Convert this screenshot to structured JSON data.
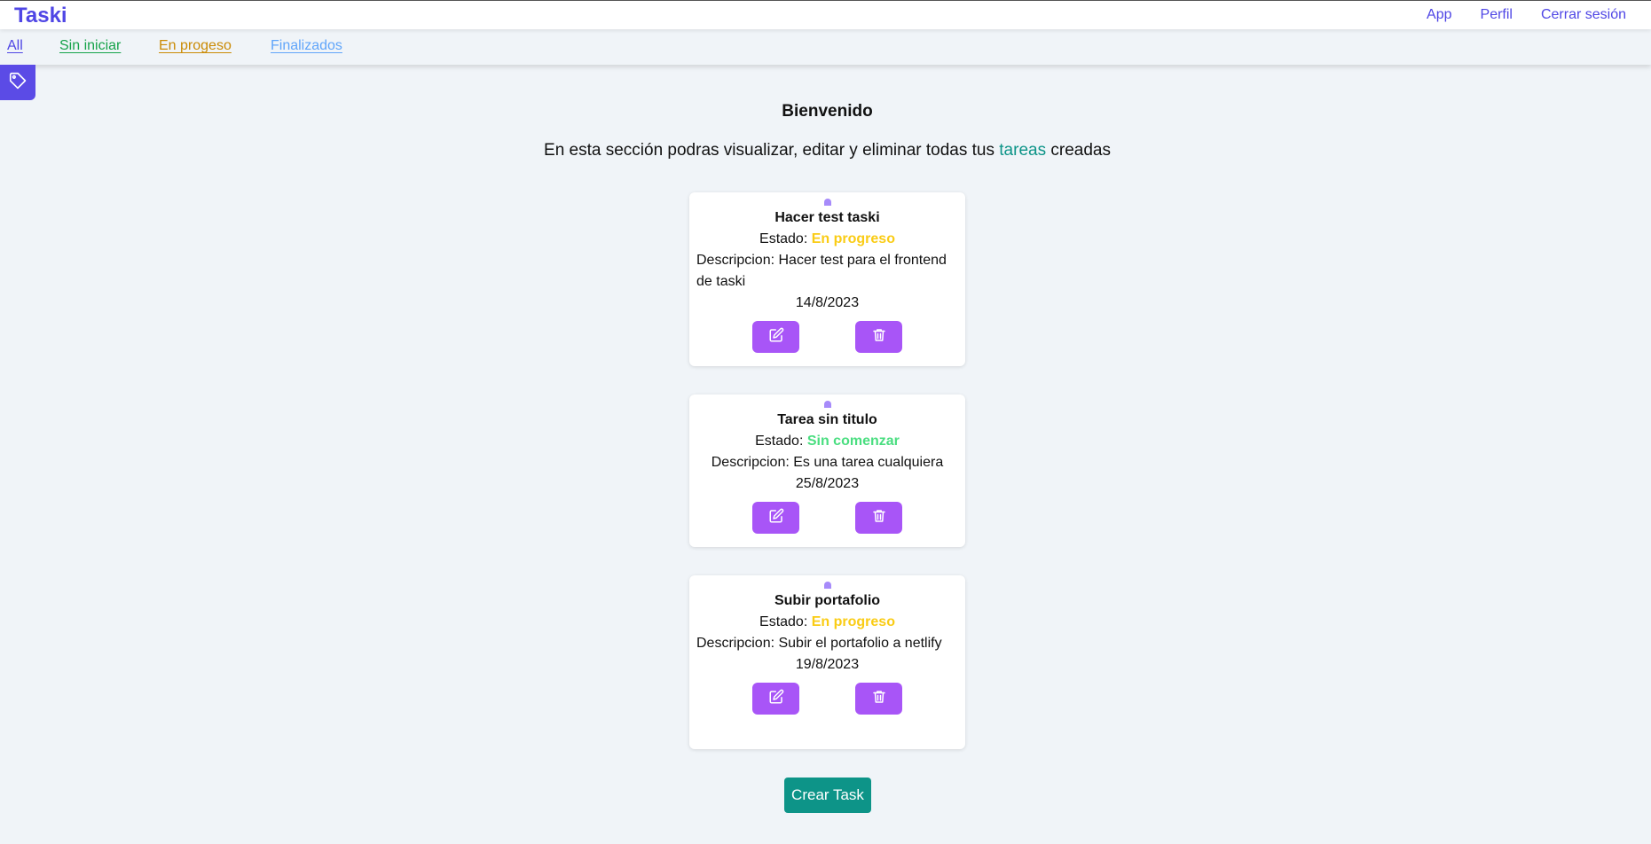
{
  "header": {
    "brand": "Taski",
    "links": [
      "App",
      "Perfil",
      "Cerrar sesión"
    ]
  },
  "filters": [
    {
      "label": "All",
      "color": "#4f46e5"
    },
    {
      "label": "Sin iniciar",
      "color": "#16a34a"
    },
    {
      "label": "En progeso",
      "color": "#ca8a04"
    },
    {
      "label": "Finalizados",
      "color": "#60a5fa"
    }
  ],
  "sidebar": {
    "icon": "tag-icon"
  },
  "main": {
    "heading": "Bienvenido",
    "intro_before": "En esta sección podras visualizar, editar y eliminar todas tus",
    "intro_accent": "tareas",
    "intro_after": "creadas"
  },
  "labels": {
    "estado": "Estado:",
    "descripcion": "Descripcion:"
  },
  "tasks": [
    {
      "title": "Hacer test taski",
      "status": "En progreso",
      "status_color": "#facc15",
      "description": "Hacer test para el frontend de taski",
      "date": "14/8/2023",
      "edit_icon": "edit-icon",
      "delete_icon": "trash-icon"
    },
    {
      "title": "Tarea sin titulo",
      "status": "Sin comenzar",
      "status_color": "#4ade80",
      "description": "Es una tarea cualquiera",
      "date": "25/8/2023",
      "edit_icon": "edit-icon",
      "delete_icon": "trash-icon"
    },
    {
      "title": "Subir portafolio",
      "status": "En progreso",
      "status_color": "#facc15",
      "description": "Subir el portafolio a netlify",
      "date": "19/8/2023",
      "edit_icon": "edit-icon",
      "delete_icon": "trash-icon"
    }
  ],
  "create_button": "Crear Task",
  "colors": {
    "brand": "#4f46e5",
    "accent": "#0d9488",
    "action": "#a855f7",
    "background": "#f0f4f8"
  }
}
